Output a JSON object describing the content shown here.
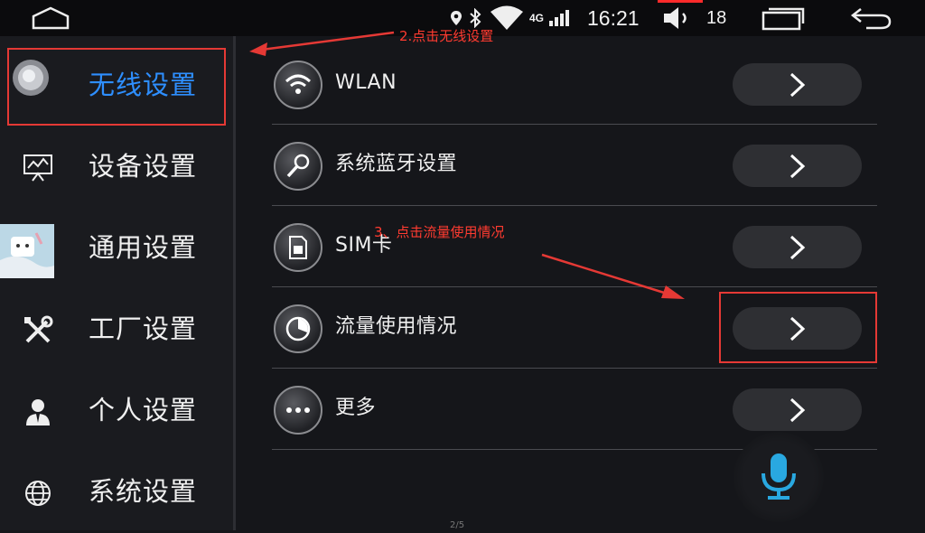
{
  "status_bar": {
    "time": "16:21",
    "network": "4G",
    "volume_level": "18"
  },
  "sidebar": {
    "items": [
      {
        "label": "无线设置",
        "icon": "wireless-icon",
        "active": true
      },
      {
        "label": "设备设置",
        "icon": "device-monitor-icon",
        "active": false
      },
      {
        "label": "通用设置",
        "icon": "general-settings-image",
        "active": false
      },
      {
        "label": "工厂设置",
        "icon": "tools-icon",
        "active": false
      },
      {
        "label": "个人设置",
        "icon": "user-icon",
        "active": false
      },
      {
        "label": "系统设置",
        "icon": "globe-icon",
        "active": false
      }
    ]
  },
  "main": {
    "rows": [
      {
        "label": "WLAN",
        "icon": "wifi-icon"
      },
      {
        "label": "系统蓝牙设置",
        "icon": "microphone-icon"
      },
      {
        "label": "SIM卡",
        "icon": "sim-card-icon"
      },
      {
        "label": "流量使用情况",
        "icon": "data-usage-icon"
      },
      {
        "label": "更多",
        "icon": "more-icon"
      }
    ]
  },
  "annotations": {
    "step2": "2.点击无线设置",
    "step3": "3、点击流量使用情况"
  },
  "page_indicator": "2/5",
  "colors": {
    "active_label": "#2e8fff",
    "annotation_red": "#e53935",
    "mic_blue": "#29a8e0"
  }
}
